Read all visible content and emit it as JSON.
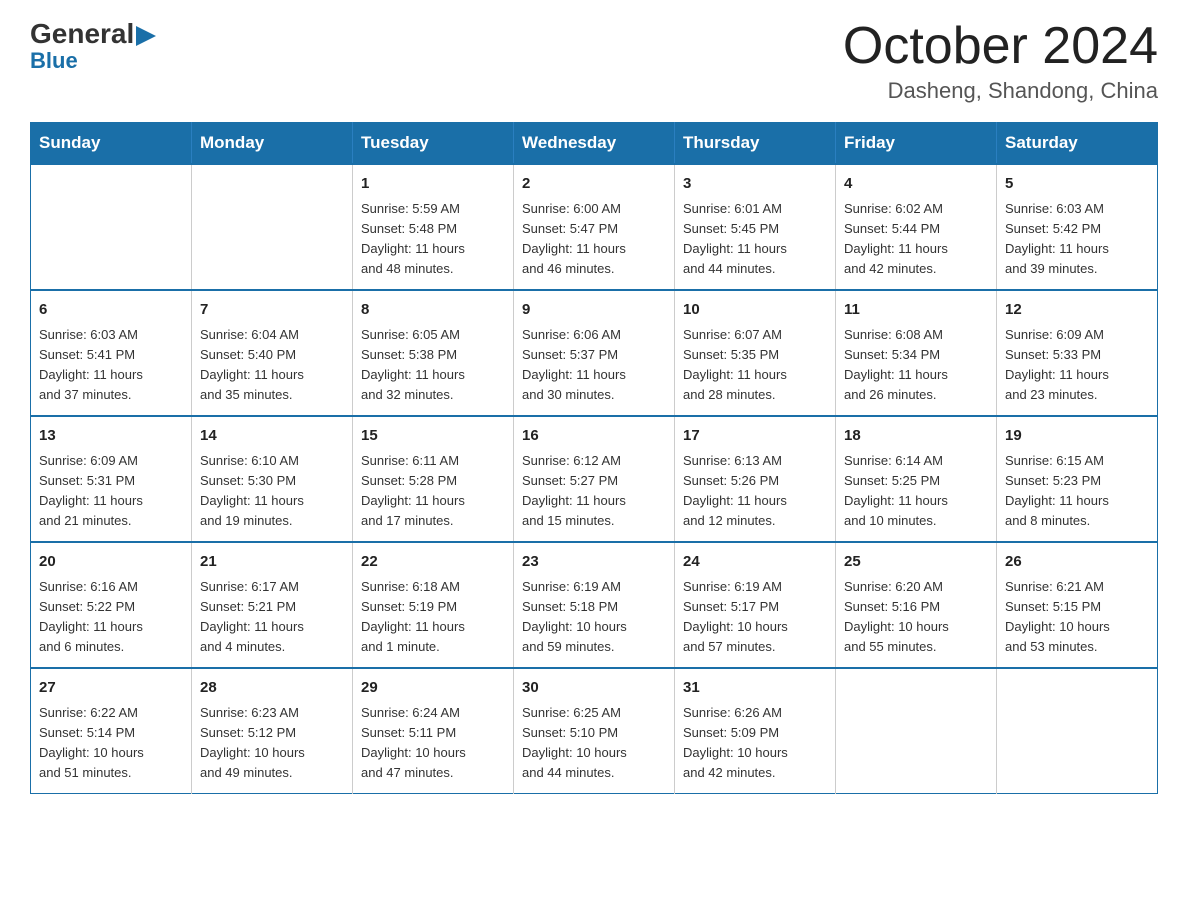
{
  "header": {
    "logo_general": "General",
    "logo_blue": "Blue",
    "month_title": "October 2024",
    "location": "Dasheng, Shandong, China"
  },
  "weekdays": [
    "Sunday",
    "Monday",
    "Tuesday",
    "Wednesday",
    "Thursday",
    "Friday",
    "Saturday"
  ],
  "weeks": [
    [
      {
        "day": "",
        "info": ""
      },
      {
        "day": "",
        "info": ""
      },
      {
        "day": "1",
        "info": "Sunrise: 5:59 AM\nSunset: 5:48 PM\nDaylight: 11 hours\nand 48 minutes."
      },
      {
        "day": "2",
        "info": "Sunrise: 6:00 AM\nSunset: 5:47 PM\nDaylight: 11 hours\nand 46 minutes."
      },
      {
        "day": "3",
        "info": "Sunrise: 6:01 AM\nSunset: 5:45 PM\nDaylight: 11 hours\nand 44 minutes."
      },
      {
        "day": "4",
        "info": "Sunrise: 6:02 AM\nSunset: 5:44 PM\nDaylight: 11 hours\nand 42 minutes."
      },
      {
        "day": "5",
        "info": "Sunrise: 6:03 AM\nSunset: 5:42 PM\nDaylight: 11 hours\nand 39 minutes."
      }
    ],
    [
      {
        "day": "6",
        "info": "Sunrise: 6:03 AM\nSunset: 5:41 PM\nDaylight: 11 hours\nand 37 minutes."
      },
      {
        "day": "7",
        "info": "Sunrise: 6:04 AM\nSunset: 5:40 PM\nDaylight: 11 hours\nand 35 minutes."
      },
      {
        "day": "8",
        "info": "Sunrise: 6:05 AM\nSunset: 5:38 PM\nDaylight: 11 hours\nand 32 minutes."
      },
      {
        "day": "9",
        "info": "Sunrise: 6:06 AM\nSunset: 5:37 PM\nDaylight: 11 hours\nand 30 minutes."
      },
      {
        "day": "10",
        "info": "Sunrise: 6:07 AM\nSunset: 5:35 PM\nDaylight: 11 hours\nand 28 minutes."
      },
      {
        "day": "11",
        "info": "Sunrise: 6:08 AM\nSunset: 5:34 PM\nDaylight: 11 hours\nand 26 minutes."
      },
      {
        "day": "12",
        "info": "Sunrise: 6:09 AM\nSunset: 5:33 PM\nDaylight: 11 hours\nand 23 minutes."
      }
    ],
    [
      {
        "day": "13",
        "info": "Sunrise: 6:09 AM\nSunset: 5:31 PM\nDaylight: 11 hours\nand 21 minutes."
      },
      {
        "day": "14",
        "info": "Sunrise: 6:10 AM\nSunset: 5:30 PM\nDaylight: 11 hours\nand 19 minutes."
      },
      {
        "day": "15",
        "info": "Sunrise: 6:11 AM\nSunset: 5:28 PM\nDaylight: 11 hours\nand 17 minutes."
      },
      {
        "day": "16",
        "info": "Sunrise: 6:12 AM\nSunset: 5:27 PM\nDaylight: 11 hours\nand 15 minutes."
      },
      {
        "day": "17",
        "info": "Sunrise: 6:13 AM\nSunset: 5:26 PM\nDaylight: 11 hours\nand 12 minutes."
      },
      {
        "day": "18",
        "info": "Sunrise: 6:14 AM\nSunset: 5:25 PM\nDaylight: 11 hours\nand 10 minutes."
      },
      {
        "day": "19",
        "info": "Sunrise: 6:15 AM\nSunset: 5:23 PM\nDaylight: 11 hours\nand 8 minutes."
      }
    ],
    [
      {
        "day": "20",
        "info": "Sunrise: 6:16 AM\nSunset: 5:22 PM\nDaylight: 11 hours\nand 6 minutes."
      },
      {
        "day": "21",
        "info": "Sunrise: 6:17 AM\nSunset: 5:21 PM\nDaylight: 11 hours\nand 4 minutes."
      },
      {
        "day": "22",
        "info": "Sunrise: 6:18 AM\nSunset: 5:19 PM\nDaylight: 11 hours\nand 1 minute."
      },
      {
        "day": "23",
        "info": "Sunrise: 6:19 AM\nSunset: 5:18 PM\nDaylight: 10 hours\nand 59 minutes."
      },
      {
        "day": "24",
        "info": "Sunrise: 6:19 AM\nSunset: 5:17 PM\nDaylight: 10 hours\nand 57 minutes."
      },
      {
        "day": "25",
        "info": "Sunrise: 6:20 AM\nSunset: 5:16 PM\nDaylight: 10 hours\nand 55 minutes."
      },
      {
        "day": "26",
        "info": "Sunrise: 6:21 AM\nSunset: 5:15 PM\nDaylight: 10 hours\nand 53 minutes."
      }
    ],
    [
      {
        "day": "27",
        "info": "Sunrise: 6:22 AM\nSunset: 5:14 PM\nDaylight: 10 hours\nand 51 minutes."
      },
      {
        "day": "28",
        "info": "Sunrise: 6:23 AM\nSunset: 5:12 PM\nDaylight: 10 hours\nand 49 minutes."
      },
      {
        "day": "29",
        "info": "Sunrise: 6:24 AM\nSunset: 5:11 PM\nDaylight: 10 hours\nand 47 minutes."
      },
      {
        "day": "30",
        "info": "Sunrise: 6:25 AM\nSunset: 5:10 PM\nDaylight: 10 hours\nand 44 minutes."
      },
      {
        "day": "31",
        "info": "Sunrise: 6:26 AM\nSunset: 5:09 PM\nDaylight: 10 hours\nand 42 minutes."
      },
      {
        "day": "",
        "info": ""
      },
      {
        "day": "",
        "info": ""
      }
    ]
  ]
}
